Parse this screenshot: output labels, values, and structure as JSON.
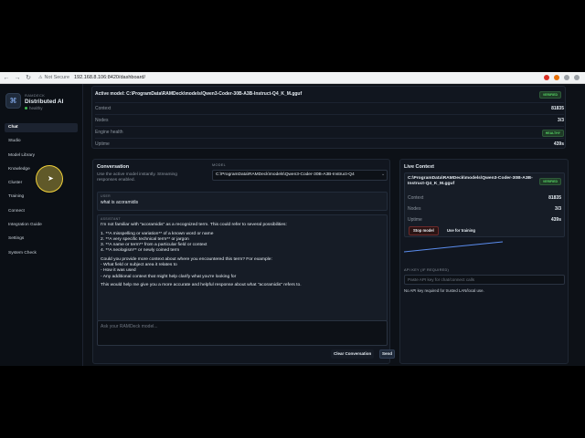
{
  "browser": {
    "security_label": "Not Secure",
    "url": "192.168.8.106:8420/dashboard/"
  },
  "sidebar": {
    "brand_small": "RAMDECK",
    "brand_title": "Distributed AI",
    "status": "healthy",
    "items": [
      {
        "label": "Chat"
      },
      {
        "label": "Studio"
      },
      {
        "label": "Model Library"
      },
      {
        "label": "Knowledge"
      },
      {
        "label": "Cluster"
      },
      {
        "label": "Training"
      },
      {
        "label": "Connect"
      },
      {
        "label": "Integration Guide"
      },
      {
        "label": "Settings"
      },
      {
        "label": "System Check"
      }
    ]
  },
  "model_card": {
    "active_model": "Active model: C:\\ProgramData\\RAMDeck\\models\\Qwen3-Coder-30B-A3B-Instruct-Q4_K_M.gguf",
    "verified": "VERIFIED",
    "stats": [
      {
        "label": "Context",
        "value": "81835"
      },
      {
        "label": "Nodes",
        "value": "3/3"
      },
      {
        "label": "Engine health",
        "value": "HEALTHY"
      },
      {
        "label": "Uptime",
        "value": "439s"
      }
    ]
  },
  "conversation": {
    "title": "Conversation",
    "description": "Use the active model instantly. Streaming responses enabled.",
    "model_label": "MODEL",
    "model_value": "C:\\ProgramData\\RAMDeck\\models\\Qwen3-Coder-30B-A3B-Instruct-Q4",
    "user_role": "USER",
    "user_text": "what is acoramidis",
    "assistant_role": "ASSISTANT",
    "assistant_lines": [
      "I'm not familiar with \"acoramidis\" as a recognized term. This could refer to several possibilities:",
      "",
      "1. **A misspelling or variation** of a known word or name",
      "2. **A very specific technical term** or jargon",
      "3. **A name or term** from a particular field or context",
      "4. **A neologism** or newly coined term",
      "",
      "Could you provide more context about where you encountered this term? For example:",
      "- What field or subject area it relates to",
      "- How it was used",
      "- Any additional context that might help clarify what you're looking for",
      "",
      "This would help me give you a more accurate and helpful response about what \"acoramidis\" refers to."
    ],
    "input_placeholder": "Ask your RAMDeck model...",
    "clear_label": "Clear Conversation",
    "send_label": "Send"
  },
  "live_context": {
    "title": "Live Context",
    "model": "C:\\ProgramData\\RAMDeck\\models\\Qwen3-Coder-30B-A3B-Instruct-Q4_K_M.gguf",
    "verified": "VERIFIED",
    "stats": [
      {
        "label": "Context",
        "value": "81835"
      },
      {
        "label": "Nodes",
        "value": "3/3"
      },
      {
        "label": "Uptime",
        "value": "439s"
      }
    ],
    "stop_label": "Stop model",
    "train_label": "Use for training",
    "api_label": "API KEY (IF REQUIRED)",
    "api_placeholder": "Paste API key for chat/connect calls",
    "api_note": "No API key required for trusted LAN/local use."
  },
  "colors": {
    "accent_green": "#3fb950",
    "stop_red": "#6e2a2a",
    "graph_blue": "#5b8def"
  }
}
